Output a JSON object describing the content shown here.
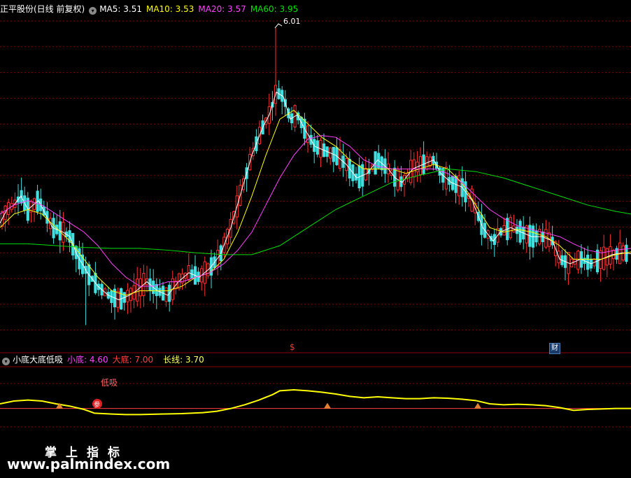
{
  "header": {
    "stock_name": "正平股份(日线 前复权)",
    "ma5": {
      "label": "MA5: 3.51",
      "color": "#ffffff"
    },
    "ma10": {
      "label": "MA10: 3.53",
      "color": "#ffff00"
    },
    "ma20": {
      "label": "MA20: 3.57",
      "color": "#ff40ff"
    },
    "ma60": {
      "label": "MA60: 3.95",
      "color": "#00e000"
    }
  },
  "indicator_header": {
    "name": "小底大底低吸",
    "small_bottom": {
      "label": "小底: 4.60",
      "color": "#ff40ff"
    },
    "big_bottom": {
      "label": "大底: 7.00",
      "color": "#ff4040"
    },
    "long_line": {
      "label": "长线: 3.70",
      "color": "#ffff60"
    }
  },
  "annotations": {
    "high_price": "6.01",
    "dividend_marker": "$",
    "finance_marker": "财",
    "low_buy_label": "低吸",
    "seal_glyph": "参"
  },
  "watermark": {
    "line1": "掌上指标",
    "line2": "www.palmindex.com"
  },
  "colors": {
    "up": "#ff3030",
    "down": "#40e0e0",
    "grid": "#8b0000",
    "indicator_line": "#ffff00",
    "baseline": "#ff4040",
    "marker": "#e08030"
  },
  "chart_data": [
    {
      "type": "candlestick",
      "title": "正平股份(日线 前复权)",
      "ylim": [
        2.6,
        6.15
      ],
      "price_high": 6.01,
      "price_low": 2.72,
      "series": [
        {
          "name": "MA5",
          "points": [
            [
              0,
              3.85
            ],
            [
              10,
              4.0
            ],
            [
              20,
              4.05
            ],
            [
              30,
              4.15
            ],
            [
              40,
              4.0
            ],
            [
              55,
              4.1
            ],
            [
              65,
              3.95
            ],
            [
              75,
              3.8
            ],
            [
              90,
              3.75
            ],
            [
              100,
              3.7
            ],
            [
              110,
              3.5
            ],
            [
              125,
              3.3
            ],
            [
              140,
              3.15
            ],
            [
              155,
              3.05
            ],
            [
              170,
              3.0
            ],
            [
              185,
              3.05
            ],
            [
              195,
              3.1
            ],
            [
              210,
              3.2
            ],
            [
              225,
              3.1
            ],
            [
              240,
              3.05
            ],
            [
              255,
              3.2
            ],
            [
              270,
              3.3
            ],
            [
              285,
              3.25
            ],
            [
              300,
              3.35
            ],
            [
              315,
              3.5
            ],
            [
              330,
              3.8
            ],
            [
              345,
              4.2
            ],
            [
              360,
              4.6
            ],
            [
              375,
              4.9
            ],
            [
              385,
              5.05
            ],
            [
              395,
              5.3
            ],
            [
              405,
              5.25
            ],
            [
              415,
              5.0
            ],
            [
              425,
              5.05
            ],
            [
              435,
              4.9
            ],
            [
              450,
              4.7
            ],
            [
              465,
              4.65
            ],
            [
              480,
              4.6
            ],
            [
              495,
              4.5
            ],
            [
              510,
              4.35
            ],
            [
              525,
              4.4
            ],
            [
              540,
              4.55
            ],
            [
              555,
              4.45
            ],
            [
              565,
              4.35
            ],
            [
              575,
              4.3
            ],
            [
              590,
              4.45
            ],
            [
              605,
              4.5
            ],
            [
              620,
              4.55
            ],
            [
              630,
              4.4
            ],
            [
              645,
              4.3
            ],
            [
              660,
              4.25
            ],
            [
              675,
              4.1
            ],
            [
              690,
              3.8
            ],
            [
              705,
              3.65
            ],
            [
              715,
              3.75
            ],
            [
              730,
              3.8
            ],
            [
              745,
              3.75
            ],
            [
              760,
              3.7
            ],
            [
              775,
              3.7
            ],
            [
              790,
              3.65
            ],
            [
              800,
              3.45
            ],
            [
              815,
              3.4
            ],
            [
              830,
              3.45
            ],
            [
              845,
              3.4
            ],
            [
              860,
              3.45
            ],
            [
              875,
              3.5
            ],
            [
              890,
              3.52
            ],
            [
              902,
              3.51
            ]
          ]
        },
        {
          "name": "MA10",
          "points": [
            [
              0,
              3.8
            ],
            [
              20,
              3.95
            ],
            [
              40,
              4.0
            ],
            [
              60,
              3.95
            ],
            [
              80,
              3.8
            ],
            [
              100,
              3.65
            ],
            [
              120,
              3.45
            ],
            [
              140,
              3.25
            ],
            [
              160,
              3.1
            ],
            [
              180,
              3.05
            ],
            [
              200,
              3.1
            ],
            [
              220,
              3.1
            ],
            [
              240,
              3.1
            ],
            [
              260,
              3.15
            ],
            [
              280,
              3.25
            ],
            [
              300,
              3.3
            ],
            [
              320,
              3.45
            ],
            [
              340,
              3.75
            ],
            [
              360,
              4.15
            ],
            [
              380,
              4.6
            ],
            [
              400,
              5.0
            ],
            [
              420,
              5.1
            ],
            [
              440,
              4.95
            ],
            [
              460,
              4.8
            ],
            [
              480,
              4.7
            ],
            [
              500,
              4.55
            ],
            [
              520,
              4.45
            ],
            [
              540,
              4.45
            ],
            [
              560,
              4.45
            ],
            [
              580,
              4.4
            ],
            [
              600,
              4.45
            ],
            [
              620,
              4.5
            ],
            [
              640,
              4.45
            ],
            [
              660,
              4.3
            ],
            [
              680,
              4.05
            ],
            [
              700,
              3.8
            ],
            [
              720,
              3.75
            ],
            [
              740,
              3.78
            ],
            [
              760,
              3.75
            ],
            [
              780,
              3.7
            ],
            [
              800,
              3.6
            ],
            [
              820,
              3.45
            ],
            [
              840,
              3.45
            ],
            [
              860,
              3.45
            ],
            [
              880,
              3.5
            ],
            [
              902,
              3.53
            ]
          ]
        },
        {
          "name": "MA20",
          "points": [
            [
              0,
              3.95
            ],
            [
              20,
              4.05
            ],
            [
              40,
              4.1
            ],
            [
              60,
              4.05
            ],
            [
              80,
              3.95
            ],
            [
              100,
              3.85
            ],
            [
              120,
              3.75
            ],
            [
              140,
              3.6
            ],
            [
              160,
              3.4
            ],
            [
              180,
              3.25
            ],
            [
              200,
              3.15
            ],
            [
              220,
              3.15
            ],
            [
              240,
              3.2
            ],
            [
              260,
              3.2
            ],
            [
              280,
              3.25
            ],
            [
              300,
              3.3
            ],
            [
              320,
              3.4
            ],
            [
              340,
              3.55
            ],
            [
              360,
              3.75
            ],
            [
              380,
              4.05
            ],
            [
              400,
              4.35
            ],
            [
              420,
              4.6
            ],
            [
              440,
              4.78
            ],
            [
              460,
              4.82
            ],
            [
              480,
              4.8
            ],
            [
              500,
              4.7
            ],
            [
              520,
              4.55
            ],
            [
              540,
              4.48
            ],
            [
              560,
              4.45
            ],
            [
              580,
              4.45
            ],
            [
              600,
              4.45
            ],
            [
              620,
              4.45
            ],
            [
              640,
              4.4
            ],
            [
              660,
              4.3
            ],
            [
              680,
              4.15
            ],
            [
              700,
              4.0
            ],
            [
              720,
              3.9
            ],
            [
              740,
              3.82
            ],
            [
              760,
              3.78
            ],
            [
              780,
              3.74
            ],
            [
              800,
              3.7
            ],
            [
              820,
              3.62
            ],
            [
              840,
              3.55
            ],
            [
              860,
              3.52
            ],
            [
              880,
              3.55
            ],
            [
              902,
              3.57
            ]
          ]
        },
        {
          "name": "MA60",
          "points": [
            [
              0,
              3.62
            ],
            [
              40,
              3.62
            ],
            [
              80,
              3.6
            ],
            [
              120,
              3.58
            ],
            [
              160,
              3.57
            ],
            [
              200,
              3.57
            ],
            [
              240,
              3.55
            ],
            [
              280,
              3.52
            ],
            [
              320,
              3.5
            ],
            [
              360,
              3.5
            ],
            [
              400,
              3.6
            ],
            [
              440,
              3.8
            ],
            [
              480,
              4.0
            ],
            [
              520,
              4.15
            ],
            [
              560,
              4.3
            ],
            [
              600,
              4.38
            ],
            [
              640,
              4.45
            ],
            [
              680,
              4.42
            ],
            [
              720,
              4.35
            ],
            [
              760,
              4.25
            ],
            [
              800,
              4.15
            ],
            [
              840,
              4.05
            ],
            [
              880,
              3.98
            ],
            [
              902,
              3.95
            ]
          ]
        }
      ]
    },
    {
      "type": "line",
      "title": "小底大底低吸",
      "series": [
        {
          "name": "长线",
          "points": [
            [
              0,
              0.22
            ],
            [
              20,
              0.28
            ],
            [
              40,
              0.3
            ],
            [
              60,
              0.28
            ],
            [
              80,
              0.22
            ],
            [
              100,
              0.17
            ],
            [
              120,
              0.1
            ],
            [
              135,
              0.02
            ],
            [
              160,
              0.0
            ],
            [
              180,
              -0.01
            ],
            [
              200,
              -0.01
            ],
            [
              230,
              0.0
            ],
            [
              260,
              0.01
            ],
            [
              290,
              0.03
            ],
            [
              310,
              0.06
            ],
            [
              330,
              0.12
            ],
            [
              350,
              0.2
            ],
            [
              370,
              0.3
            ],
            [
              390,
              0.42
            ],
            [
              400,
              0.5
            ],
            [
              420,
              0.52
            ],
            [
              440,
              0.5
            ],
            [
              460,
              0.47
            ],
            [
              480,
              0.43
            ],
            [
              500,
              0.38
            ],
            [
              520,
              0.35
            ],
            [
              540,
              0.37
            ],
            [
              560,
              0.35
            ],
            [
              580,
              0.33
            ],
            [
              600,
              0.33
            ],
            [
              620,
              0.35
            ],
            [
              640,
              0.34
            ],
            [
              660,
              0.32
            ],
            [
              680,
              0.29
            ],
            [
              700,
              0.22
            ],
            [
              720,
              0.2
            ],
            [
              740,
              0.21
            ],
            [
              760,
              0.2
            ],
            [
              780,
              0.18
            ],
            [
              800,
              0.14
            ],
            [
              820,
              0.08
            ],
            [
              840,
              0.1
            ],
            [
              860,
              0.11
            ],
            [
              880,
              0.12
            ],
            [
              902,
              0.12
            ]
          ]
        }
      ],
      "baseline": 0.12,
      "markers_x": [
        85,
        468,
        683
      ]
    }
  ]
}
